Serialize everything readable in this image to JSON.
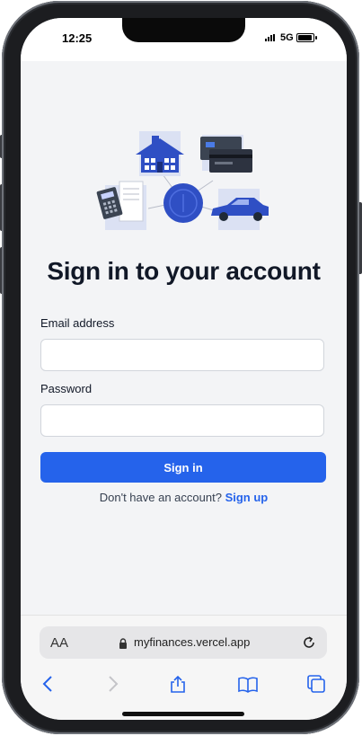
{
  "status_bar": {
    "time": "12:25",
    "network": "5G"
  },
  "illustration": {
    "icons": [
      "house-icon",
      "credit-cards-icon",
      "calculator-icon",
      "coin-icon",
      "car-icon"
    ],
    "accent_color": "#2f4fc4"
  },
  "page": {
    "title": "Sign in to your account",
    "email_label": "Email address",
    "email_value": "",
    "password_label": "Password",
    "password_value": "",
    "submit_label": "Sign in",
    "signup_prompt": "Don't have an account?",
    "signup_link": "Sign up"
  },
  "browser": {
    "text_size_label": "AA",
    "url": "myfinances.vercel.app",
    "toolbar_icons": [
      "back-icon",
      "forward-icon",
      "share-icon",
      "bookmarks-icon",
      "tabs-icon"
    ]
  },
  "colors": {
    "primary": "#2563eb",
    "background": "#f3f4f6",
    "text": "#111827"
  }
}
